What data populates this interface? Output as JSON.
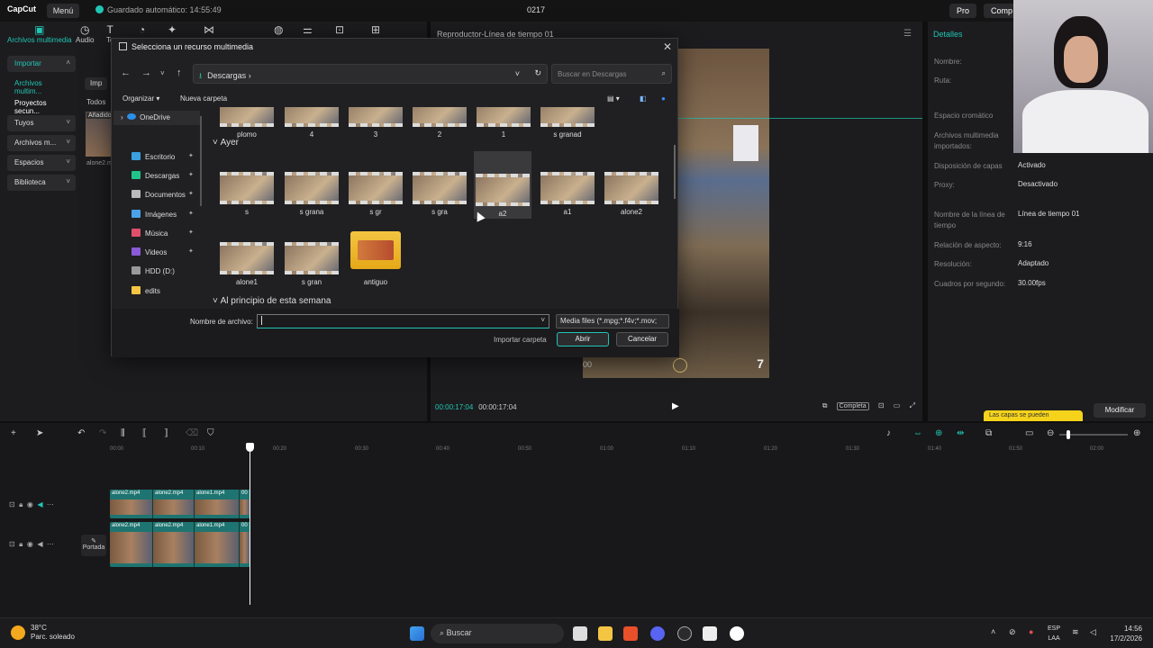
{
  "app": {
    "logo": "CapCut",
    "menu_label": "Menú",
    "autosave": "Guardado automático: 14:55:49",
    "project_name": "0217",
    "pro_label": "Pro",
    "share_label": "Comp"
  },
  "toolbar": {
    "items": [
      {
        "label": "Archivos multimedia",
        "icon": "media-icon"
      },
      {
        "label": "Audio",
        "icon": "audio-icon"
      },
      {
        "label": "Te",
        "icon": "text-icon"
      }
    ]
  },
  "sidebar": {
    "items": [
      {
        "label": "Importar"
      },
      {
        "label": "Archivos multim..."
      },
      {
        "label": "Proyectos secun..."
      },
      {
        "label": "Tuyos"
      },
      {
        "label": "Archivos m..."
      },
      {
        "label": "Espacios"
      },
      {
        "label": "Biblioteca"
      }
    ],
    "tab_label": "Imp",
    "filter_label": "Todos",
    "added_badge": "Añadido",
    "clip_name": "alone2.m"
  },
  "player": {
    "title": "Reproductor-Línea de tiempo 01",
    "timecode_current": "00:00:17:04",
    "timecode_total": "00:00:17:04",
    "ratio_label": "Completa",
    "overlay_number": "7",
    "hud_label": "00"
  },
  "details": {
    "title": "Detalles",
    "rows": [
      {
        "label": "Nombre:",
        "value": ""
      },
      {
        "label": "Ruta:",
        "value": ""
      },
      {
        "label": "Espacio cromático",
        "value": ""
      },
      {
        "label": "Archivos multimedia importados:",
        "value": ""
      },
      {
        "label": "Disposición de capas",
        "value": "Activado"
      },
      {
        "label": "Proxy:",
        "value": "Desactivado"
      },
      {
        "label": "Nombre de la línea de tiempo",
        "value": "Línea de tiempo 01"
      },
      {
        "label": "Relación de aspecto:",
        "value": "9:16"
      },
      {
        "label": "Resolución:",
        "value": "Adaptado"
      },
      {
        "label": "Cuadros por segundo:",
        "value": "30.00fps"
      }
    ],
    "tooltip": "Las capas se pueden",
    "modify_label": "Modificar"
  },
  "timeline": {
    "ruler": [
      "00:00",
      "00:10",
      "00:20",
      "00:30",
      "00:40",
      "00:50",
      "01:00",
      "01:10",
      "01:20",
      "01:30",
      "01:40",
      "01:50",
      "02:00"
    ],
    "clips_top": [
      "alone2.mp4",
      "alone2.mp4",
      "alone1.mp4",
      "00"
    ],
    "cover_label": "Portada"
  },
  "dialog": {
    "title": "Selecciona un recurso multimedia",
    "path": "Descargas",
    "search_placeholder": "Buscar en Descargas",
    "organize_label": "Organizar",
    "new_folder_label": "Nueva carpeta",
    "nav_items": [
      {
        "label": "OneDrive",
        "color": "#2b8fe8"
      },
      {
        "label": "Escritorio",
        "color": "#3aa0e0"
      },
      {
        "label": "Descargas",
        "color": "#21c58a"
      },
      {
        "label": "Documentos",
        "color": "#bbbbbb"
      },
      {
        "label": "Imágenes",
        "color": "#4aa3e8"
      },
      {
        "label": "Música",
        "color": "#e0506a"
      },
      {
        "label": "Videos",
        "color": "#8a5ad8"
      },
      {
        "label": "HDD (D:)",
        "color": "#999999"
      },
      {
        "label": "edits",
        "color": "#f3c542"
      }
    ],
    "top_row": [
      "plomo",
      "4",
      "3",
      "2",
      "1",
      "s granad"
    ],
    "group_yesterday": "Ayer",
    "yesterday_row1": [
      "s",
      "s grana",
      "s gr",
      "s gra",
      "a2",
      "a1",
      "alone2"
    ],
    "yesterday_row2": [
      "alone1",
      "s gran",
      "antiguo"
    ],
    "group_week": "Al principio de esta semana",
    "filename_label": "Nombre de archivo:",
    "filename_value": "",
    "filetype": "Media files (*.mpg;*.f4v;*.mov;",
    "import_folder_label": "Importar carpeta",
    "open_label": "Abrir",
    "cancel_label": "Cancelar"
  },
  "taskbar": {
    "temp": "38°C",
    "weather": "Parc. soleado",
    "search_label": "Buscar",
    "lang1": "ESP",
    "lang2": "LAA",
    "time": "14:56",
    "date": "17/2/2026"
  }
}
